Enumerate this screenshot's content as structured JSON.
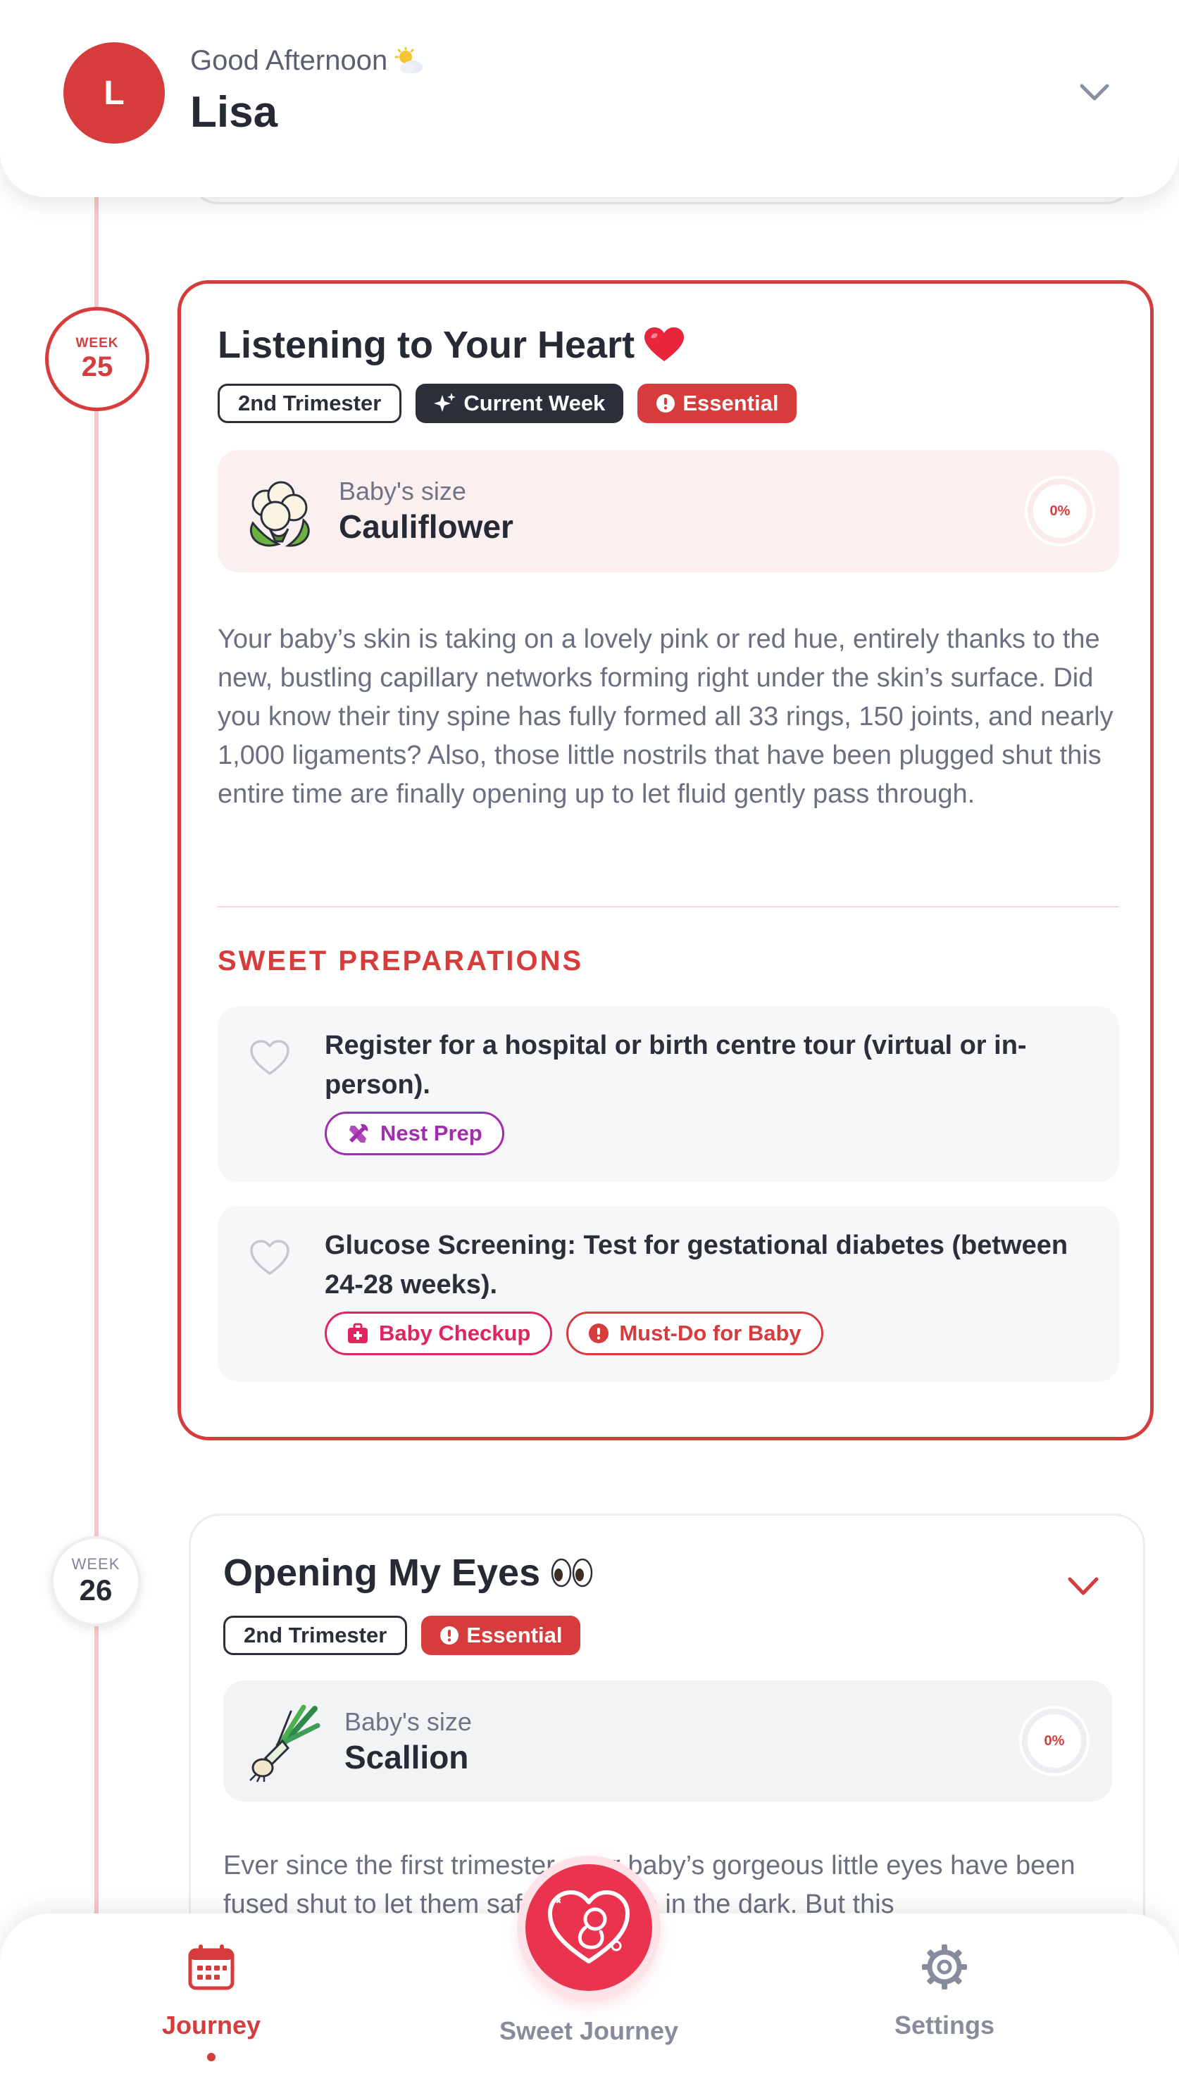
{
  "header": {
    "avatar_initial": "L",
    "greeting": "Good Afternoon",
    "greeting_icon": "sun-behind-cloud-icon",
    "username": "Lisa"
  },
  "weeks": [
    {
      "label": "WEEK",
      "number": "25",
      "title": "Listening to Your Heart",
      "title_emoji": "❤️",
      "chips": [
        "2nd Trimester",
        "Current Week",
        "Essential"
      ],
      "size_label": "Baby's size",
      "size_value": "Cauliflower",
      "size_icon": "cauliflower-icon",
      "progress": "0%",
      "description": "Your baby’s skin is taking on a lovely pink or red hue, entirely thanks to the new, bustling capillary networks forming right under the skin’s surface. Did you know their tiny spine has fully formed all 33 rings, 150 joints, and nearly 1,000 ligaments? Also, those little nostrils that have been plugged shut this entire time are finally opening up to let fluid gently pass through.",
      "section_title": "SWEET PREPARATIONS",
      "tasks": [
        {
          "text": "Register for a hospital or birth centre tour (virtual or in-person).",
          "tags": [
            "Nest Prep"
          ]
        },
        {
          "text": "Glucose Screening: Test for gestational diabetes (between 24-28 weeks).",
          "tags": [
            "Baby Checkup",
            "Must-Do for Baby"
          ]
        }
      ]
    },
    {
      "label": "WEEK",
      "number": "26",
      "title": "Opening My Eyes",
      "title_emoji": "👀",
      "chips": [
        "2nd Trimester",
        "Essential"
      ],
      "size_label": "Baby's size",
      "size_value": "Scallion",
      "size_icon": "scallion-icon",
      "progress": "0%",
      "description": "Ever since the first trimester, your baby’s gorgeous little eyes have been fused shut to let them safely develop in the dark. But this"
    }
  ],
  "nav": {
    "journey": "Journey",
    "sweet_journey": "Sweet Journey",
    "settings": "Settings"
  },
  "colors": {
    "accent": "#d63c3c",
    "pink_accent": "#e9334f",
    "purple_tag": "#a22bb0",
    "magenta_tag": "#e0245e"
  }
}
